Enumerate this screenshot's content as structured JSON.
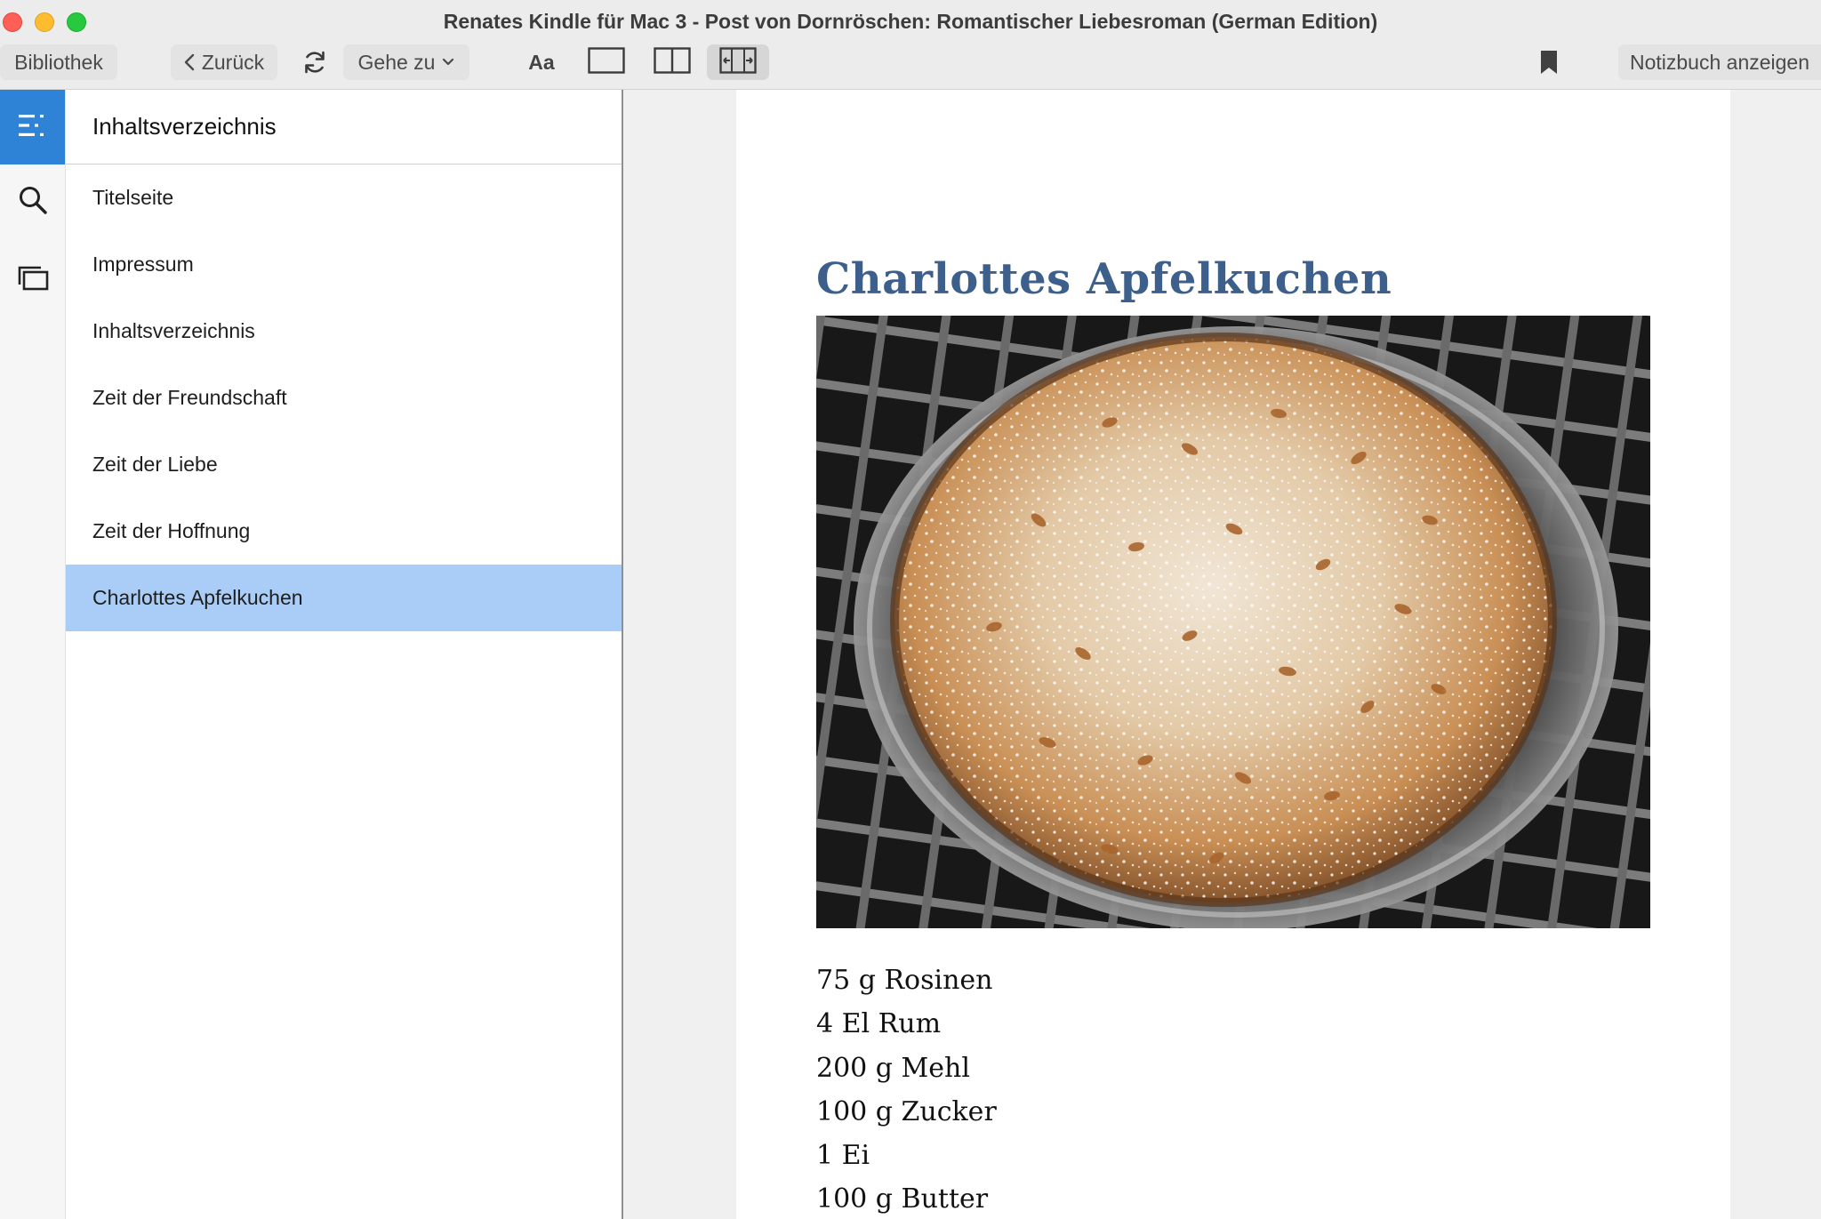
{
  "window": {
    "title": "Renates Kindle für Mac 3 - Post von Dornröschen: Romantischer Liebesroman (German Edition)"
  },
  "toolbar": {
    "library_label": "Bibliothek",
    "back_label": "Zurück",
    "goto_label": "Gehe zu",
    "font_label": "Aa",
    "notebook_label": "Notizbuch anzeigen",
    "layout_active": "single-column-scroll"
  },
  "rail": {
    "items": [
      {
        "icon": "table-of-contents-icon",
        "active": true
      },
      {
        "icon": "search-icon",
        "active": false
      },
      {
        "icon": "flashcards-icon",
        "active": false
      }
    ],
    "accent_color": "#2f83d6"
  },
  "toc": {
    "header": "Inhaltsverzeichnis",
    "items": [
      {
        "label": "Titelseite"
      },
      {
        "label": "Impressum"
      },
      {
        "label": "Inhaltsverzeichnis"
      },
      {
        "label": "Zeit der Freundschaft"
      },
      {
        "label": "Zeit der Liebe"
      },
      {
        "label": "Zeit der Hoffnung"
      },
      {
        "label": "Charlottes Apfelkuchen"
      }
    ],
    "selected_index": 6,
    "selected_color": "#a9cdf6"
  },
  "page": {
    "chapter_title": "Charlottes Apfelkuchen",
    "title_color": "#3d5f8c",
    "ingredients": [
      "75 g Rosinen",
      "4 El Rum",
      "200 g Mehl",
      "100 g Zucker",
      "1 Ei",
      "100 g Butter"
    ]
  }
}
